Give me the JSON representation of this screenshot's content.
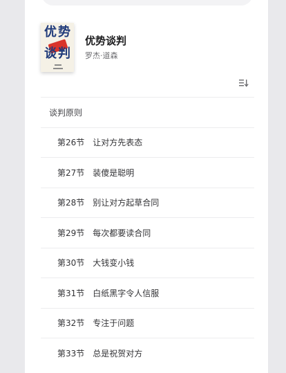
{
  "book": {
    "title": "优势谈判",
    "author": "罗杰·道森",
    "cover_text": [
      "优",
      "势",
      "谈",
      "判"
    ]
  },
  "toc": {
    "part_title": "谈判原则",
    "sections": [
      {
        "num": "第26节",
        "title": "让对方先表态"
      },
      {
        "num": "第27节",
        "title": "装傻是聪明"
      },
      {
        "num": "第28节",
        "title": "别让对方起草合同"
      },
      {
        "num": "第29节",
        "title": "每次都要读合同"
      },
      {
        "num": "第30节",
        "title": "大钱变小钱"
      },
      {
        "num": "第31节",
        "title": "白纸黑字令人信服"
      },
      {
        "num": "第32节",
        "title": "专注于问题"
      },
      {
        "num": "第33节",
        "title": "总是祝贺对方"
      }
    ]
  },
  "icons": {
    "sort": "sort-icon"
  },
  "colors": {
    "background": "#e9e9ec",
    "panel": "#ffffff",
    "divider": "#ececee",
    "cover_blue": "#1f3a7a",
    "cover_red": "#d9352b"
  }
}
